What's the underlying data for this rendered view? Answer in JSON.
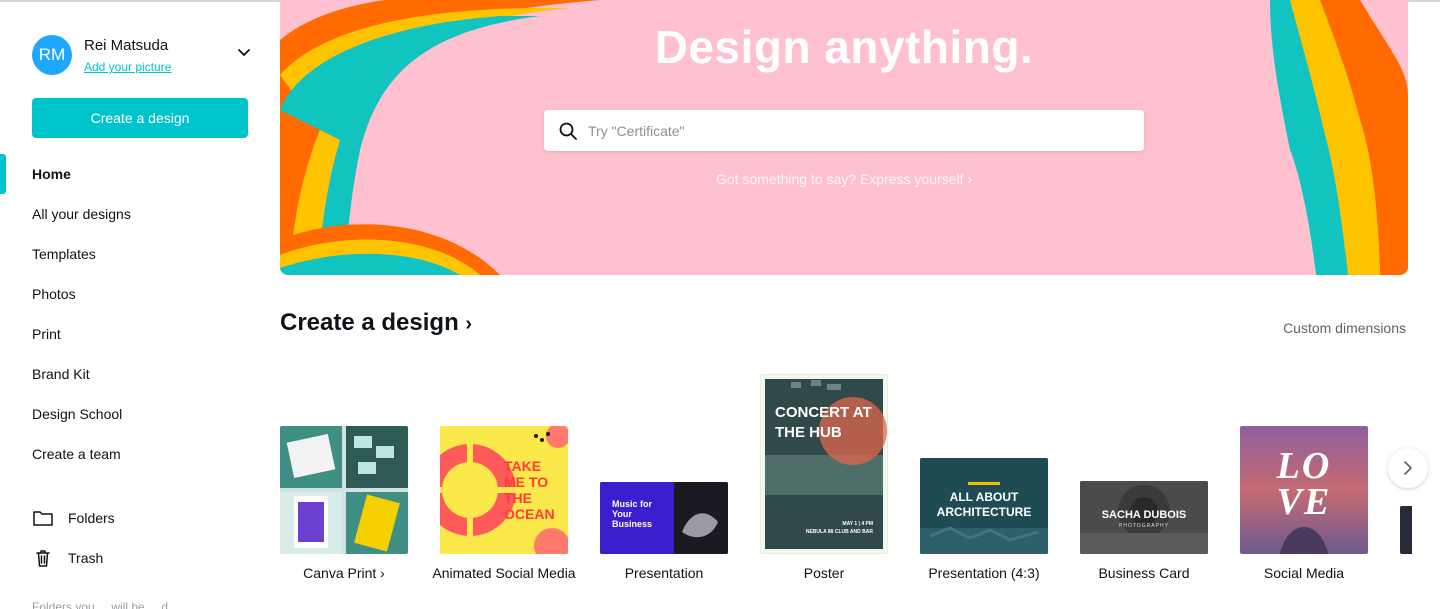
{
  "user": {
    "initials": "RM",
    "name": "Rei Matsuda",
    "add_picture": "Add your picture"
  },
  "sidebar": {
    "create_button": "Create a design",
    "nav": [
      {
        "label": "Home",
        "active": true
      },
      {
        "label": "All your designs"
      },
      {
        "label": "Templates"
      },
      {
        "label": "Photos"
      },
      {
        "label": "Print"
      },
      {
        "label": "Brand Kit"
      },
      {
        "label": "Design School"
      },
      {
        "label": "Create a team"
      }
    ],
    "folders": "Folders",
    "trash": "Trash",
    "faded_note": "Folders you ... will be ... d ..."
  },
  "hero": {
    "title": "Design anything.",
    "search_placeholder": "Try \"Certificate\"",
    "link": "Got something to say? Express yourself ›"
  },
  "create_section": {
    "title": "Create a design",
    "custom_dimensions": "Custom dimensions",
    "cards": [
      {
        "label": "Canva Print ›"
      },
      {
        "label": "Animated Social Media"
      },
      {
        "label": "Presentation",
        "thumb_text": "Music for Your Business"
      },
      {
        "label": "Poster",
        "thumb_text": "CONCERT AT THE HUB",
        "thumb_sub": "MAY 1 | 4 PM",
        "thumb_sub2": "NEBULA 88 CLUB AND BAR"
      },
      {
        "label": "Presentation (4:3)",
        "thumb_text": "ALL ABOUT ARCHITECTURE"
      },
      {
        "label": "Business Card",
        "thumb_text": "SACHA DUBOIS",
        "thumb_sub": "PHOTOGRAPHY"
      },
      {
        "label": "Social Media",
        "thumb_text": "LOVE"
      }
    ],
    "animated_thumb_text": "TAKE ME TO THE OCEAN"
  },
  "colors": {
    "accent": "#00c4cc",
    "hero_bg": "#ffc0cf",
    "avatar": "#1ea7fd"
  }
}
